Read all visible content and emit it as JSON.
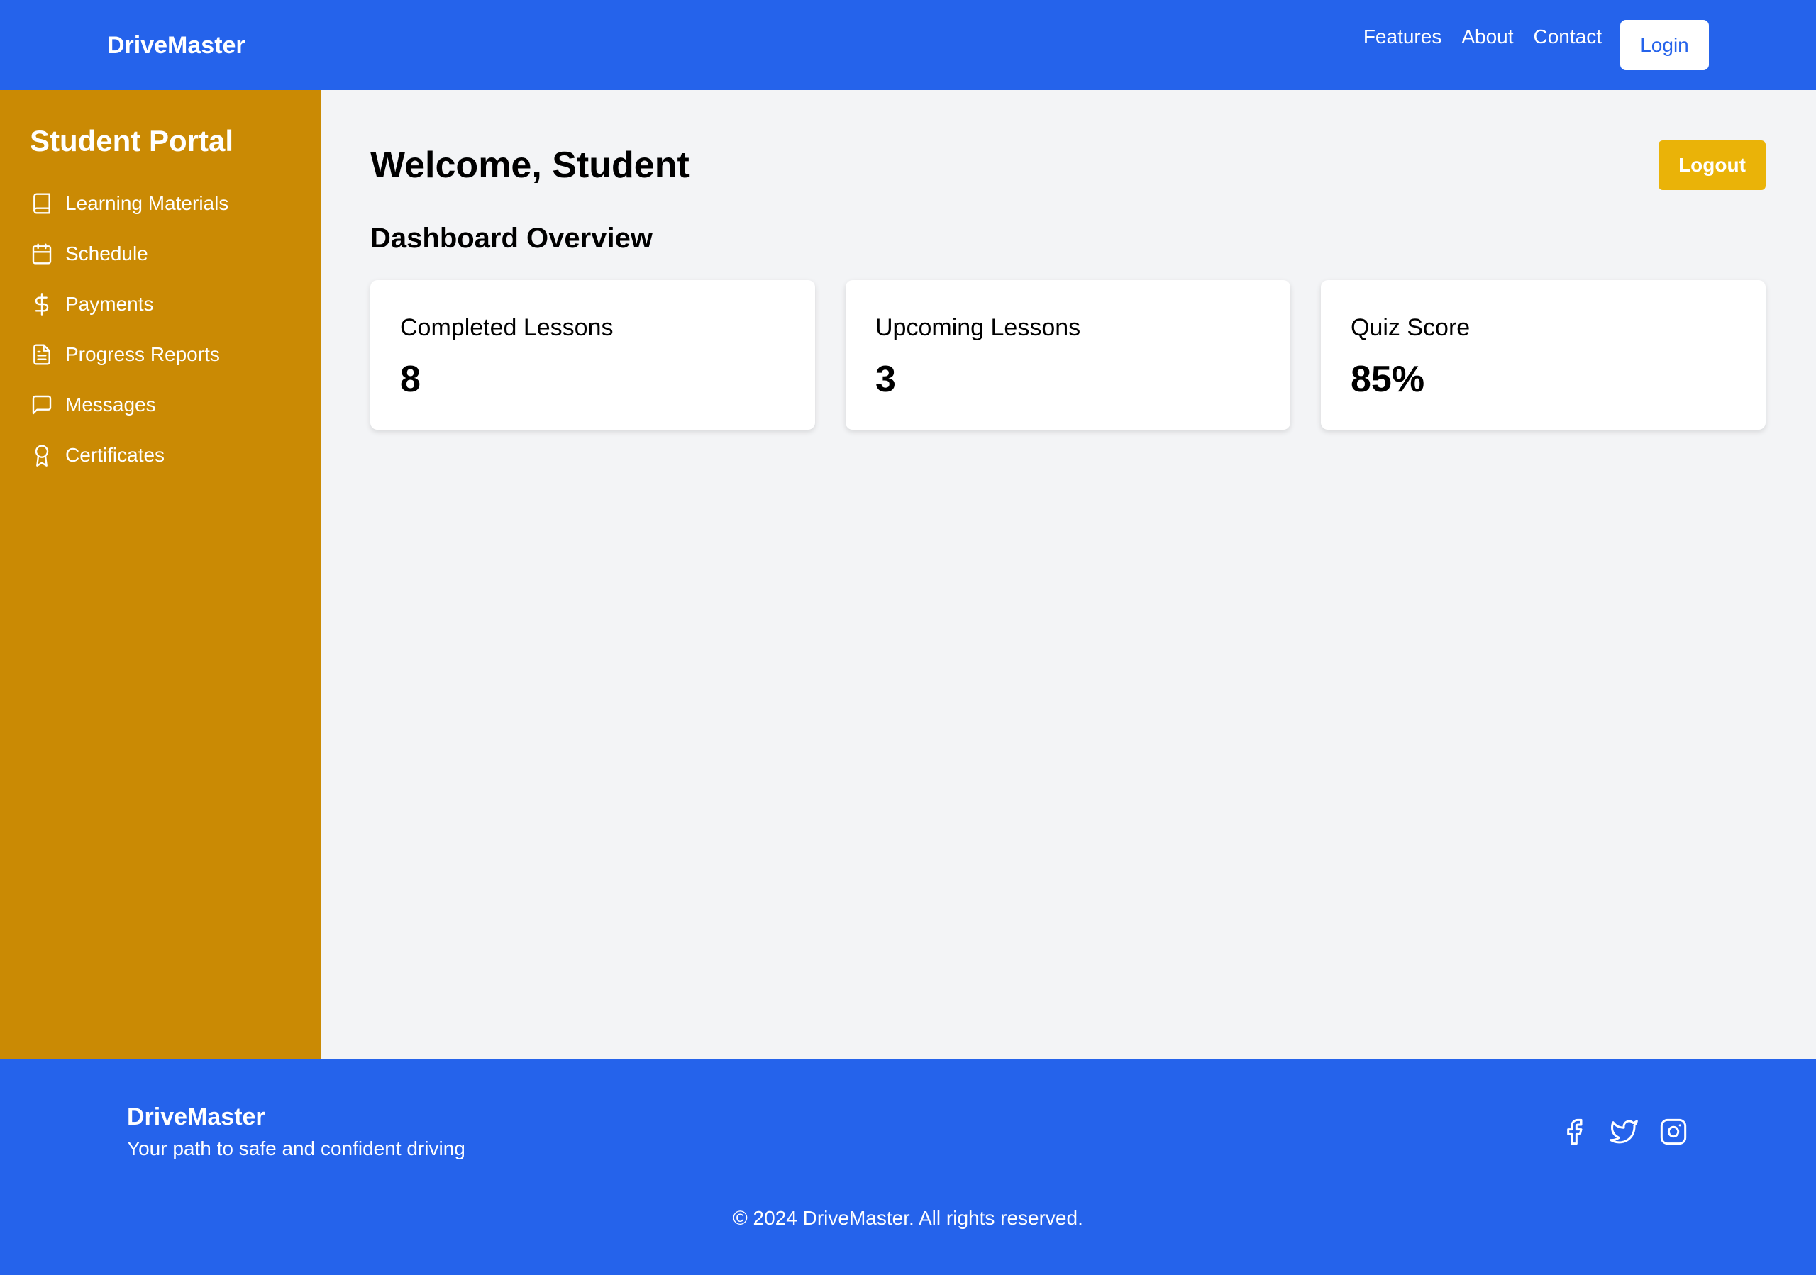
{
  "header": {
    "brand": "DriveMaster",
    "nav": [
      "Features",
      "About",
      "Contact"
    ],
    "login_label": "Login"
  },
  "sidebar": {
    "title": "Student Portal",
    "items": [
      {
        "label": "Learning Materials",
        "icon": "book-icon"
      },
      {
        "label": "Schedule",
        "icon": "calendar-icon"
      },
      {
        "label": "Payments",
        "icon": "dollar-icon"
      },
      {
        "label": "Progress Reports",
        "icon": "file-text-icon"
      },
      {
        "label": "Messages",
        "icon": "message-icon"
      },
      {
        "label": "Certificates",
        "icon": "award-icon"
      }
    ]
  },
  "main": {
    "welcome": "Welcome, Student",
    "logout_label": "Logout",
    "overview_title": "Dashboard Overview",
    "cards": [
      {
        "label": "Completed Lessons",
        "value": "8"
      },
      {
        "label": "Upcoming Lessons",
        "value": "3"
      },
      {
        "label": "Quiz Score",
        "value": "85%"
      }
    ]
  },
  "footer": {
    "brand": "DriveMaster",
    "tagline": "Your path to safe and confident driving",
    "social": [
      "facebook-icon",
      "twitter-icon",
      "instagram-icon"
    ],
    "copyright": "© 2024 DriveMaster. All rights reserved."
  },
  "colors": {
    "primary": "#2563eb",
    "sidebar": "#ca8a04",
    "logout": "#eab308",
    "background": "#f3f4f6"
  }
}
